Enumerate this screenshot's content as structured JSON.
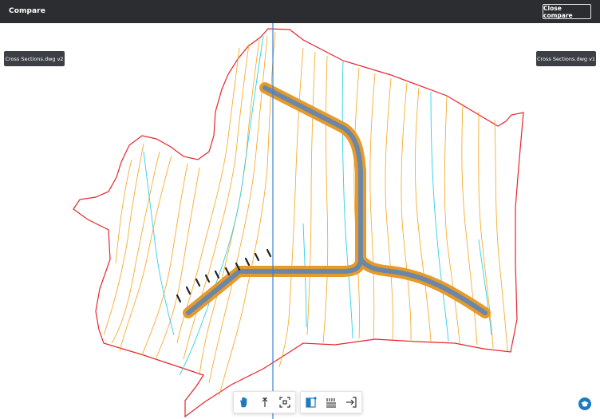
{
  "header": {
    "title": "Compare",
    "close_button_label": "Close compare"
  },
  "viewer": {
    "left_version_label": "Cross Sections.dwg v2",
    "right_version_label": "Cross Sections.dwg v1"
  },
  "toolbar": {
    "navigation_tools": [
      {
        "name": "pan",
        "icon": "hand-icon",
        "active": true
      },
      {
        "name": "zoom",
        "icon": "zoom-arrows-icon",
        "active": false
      },
      {
        "name": "fit-to-view",
        "icon": "fit-view-icon",
        "active": false
      }
    ],
    "view_tools": [
      {
        "name": "compare-mode",
        "icon": "split-compare-icon",
        "active": true
      },
      {
        "name": "layers",
        "icon": "layers-icon",
        "active": false
      },
      {
        "name": "export",
        "icon": "export-icon",
        "active": false
      }
    ]
  },
  "colors": {
    "header_bg": "#2b2d30",
    "boundary": "#e8242c",
    "contour_orange": "#f5a31a",
    "contour_cyan": "#2cd0e3",
    "road_fill": "#e59a2a",
    "road_center": "#6a86a8",
    "split_line": "#3a82d6",
    "accent": "#1a7bbf"
  }
}
